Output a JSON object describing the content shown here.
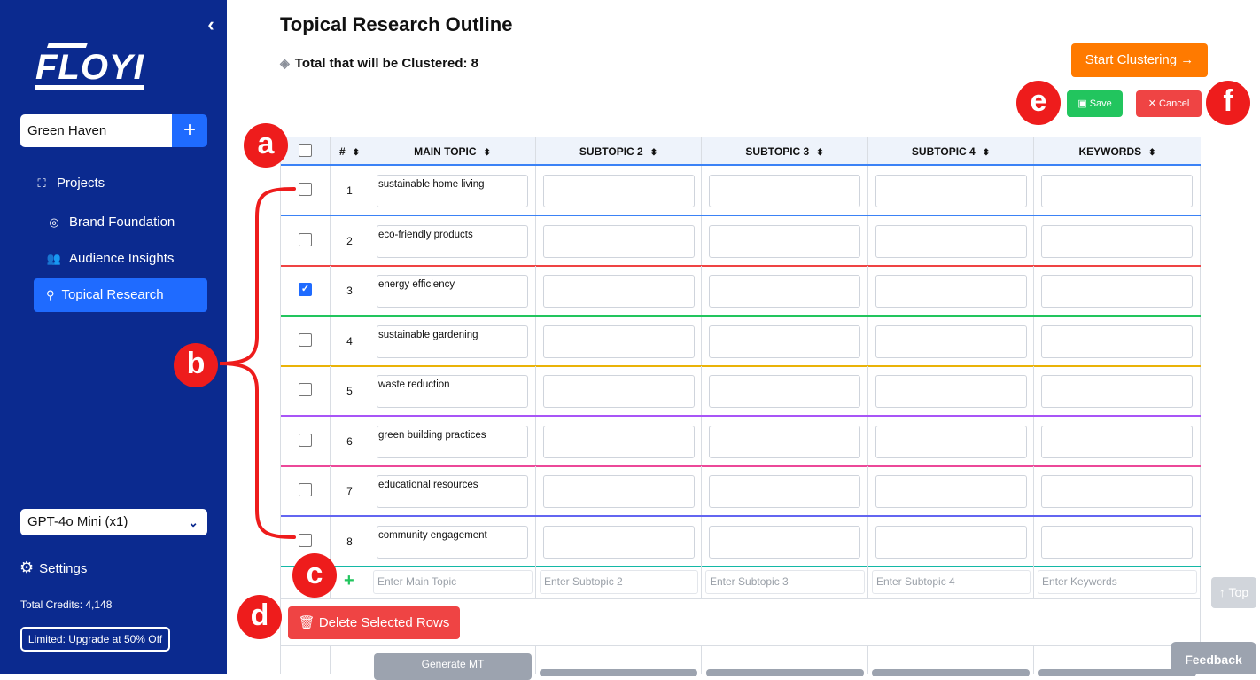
{
  "sidebar": {
    "logo": "FLOYI",
    "project": "Green Haven",
    "nav": {
      "projects": "Projects",
      "brand": "Brand Foundation",
      "audience": "Audience Insights",
      "topical": "Topical Research"
    },
    "model": "GPT-4o Mini (x1)",
    "settings": "Settings",
    "credits": "Total Credits: 4,148",
    "upgrade": "Limited: Upgrade at 50% Off"
  },
  "header": {
    "title": "Topical Research Outline",
    "total": "Total that will be Clustered: 8",
    "cluster_btn": "Start Clustering",
    "save_btn": "Save",
    "cancel_btn": "Cancel"
  },
  "table": {
    "columns": [
      "#",
      "MAIN TOPIC",
      "SUBTOPIC 2",
      "SUBTOPIC 3",
      "SUBTOPIC 4",
      "KEYWORDS"
    ],
    "rows": [
      {
        "num": "1",
        "main": "sustainable home living",
        "checked": false,
        "color": "#3b82f6"
      },
      {
        "num": "2",
        "main": "eco-friendly products",
        "checked": false,
        "color": "#ef4444"
      },
      {
        "num": "3",
        "main": "energy efficiency",
        "checked": true,
        "color": "#22c55e"
      },
      {
        "num": "4",
        "main": "sustainable gardening",
        "checked": false,
        "color": "#eab308"
      },
      {
        "num": "5",
        "main": "waste reduction",
        "checked": false,
        "color": "#a855f7"
      },
      {
        "num": "6",
        "main": "green building practices",
        "checked": false,
        "color": "#ec4899"
      },
      {
        "num": "7",
        "main": "educational resources",
        "checked": false,
        "color": "#6366f1"
      },
      {
        "num": "8",
        "main": "community engagement",
        "checked": false,
        "color": "#14b8a6"
      }
    ],
    "placeholders": {
      "main": "Enter Main Topic",
      "sub2": "Enter Subtopic 2",
      "sub3": "Enter Subtopic 3",
      "sub4": "Enter Subtopic 4",
      "keywords": "Enter Keywords"
    },
    "delete_btn": "Delete Selected Rows",
    "generate_btn": "Generate MT"
  },
  "annotations": [
    "a",
    "b",
    "c",
    "d",
    "e",
    "f"
  ],
  "floating": {
    "top": "↑ Top",
    "feedback": "Feedback"
  }
}
